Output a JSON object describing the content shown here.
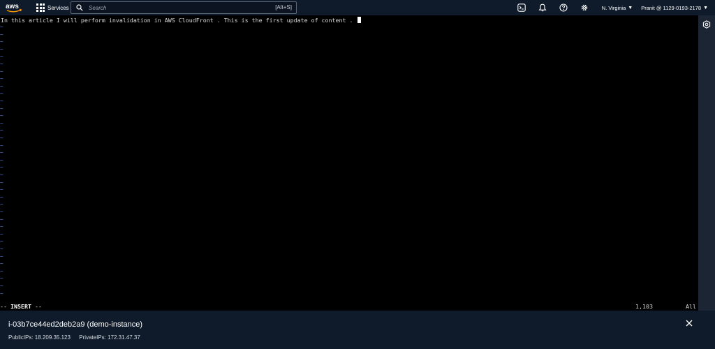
{
  "nav": {
    "logo_text": "aws",
    "services_label": "Services",
    "search_placeholder": "Search",
    "search_shortcut": "[Alt+S]",
    "region": "N. Virginia",
    "account": "Pranit @ 1129-0193-2178"
  },
  "terminal": {
    "text": "In this article I will perform invalidation in AWS CloudFront . This is the first update of content . ",
    "tilde": "~",
    "mode": "-- INSERT --",
    "mode_prefix": "-- ",
    "mode_word": "INSERT",
    "mode_suffix": " --",
    "position": "1,103",
    "scroll": "All"
  },
  "panel": {
    "instance_title": "i-03b7ce44ed2deb2a9 (demo-instance)",
    "public_ips": "PublicIPs: 18.209.35.123",
    "private_ips": "PrivateIPs: 172.31.47.37"
  },
  "colors": {
    "nav_bg": "#0f1b2a",
    "terminal_bg": "#000000",
    "tilde": "#4a7bd0",
    "text": "#d9d9d9"
  }
}
